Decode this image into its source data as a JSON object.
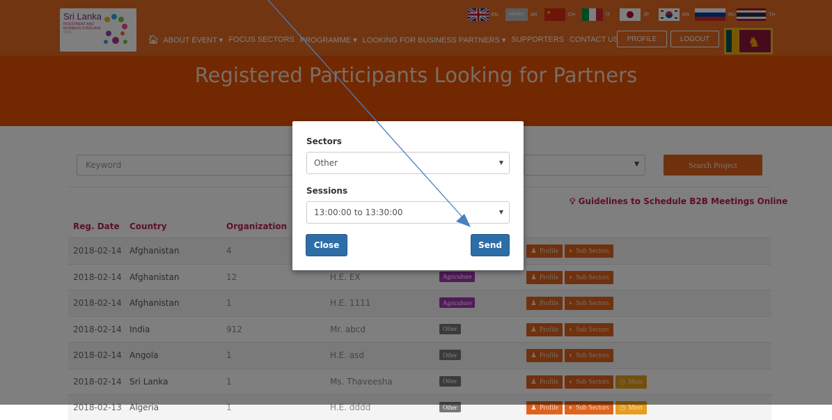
{
  "languages": [
    {
      "code": "EN"
    },
    {
      "code": "ARABIC",
      "label": "AR"
    },
    {
      "code": "CH"
    },
    {
      "code": "IT"
    },
    {
      "code": "JP"
    },
    {
      "code": "KN"
    },
    {
      "code": "RU"
    },
    {
      "code": "TH"
    }
  ],
  "logo": {
    "title": "Sri Lanka",
    "subtitle": "INVESTMENT AND BUSINESS CONCLAVE",
    "year": "2018"
  },
  "nav": {
    "items": [
      "ABOUT EVENT",
      "FOCUS SECTORS",
      "PROGRAMME",
      "LOOKING FOR BUSINESS PARTNERS",
      "SUPPORTERS",
      "CONTACT US"
    ],
    "dropdowns": [
      true,
      false,
      true,
      true,
      false,
      false
    ],
    "profile": "PROFILE",
    "logout": "LOGOUT"
  },
  "hero": {
    "title": "Registered Participants Looking for Partners"
  },
  "search": {
    "keyword_placeholder": "Keyword",
    "search_button": "Search Project"
  },
  "guidelines": "Guidelines to Schedule B2B Meetings Online",
  "table": {
    "headers": [
      "Reg. Date",
      "Country",
      "Organization"
    ],
    "rows": [
      {
        "date": "2018-02-14",
        "country": "Afghanistan",
        "org": "4",
        "name": "",
        "sector": "",
        "meet": false
      },
      {
        "date": "2018-02-14",
        "country": "Afghanistan",
        "org": "12",
        "name": "H.E. EX",
        "sector": "Agriculture",
        "meet": false
      },
      {
        "date": "2018-02-14",
        "country": "Afghanistan",
        "org": "1",
        "name": "H.E. 1111",
        "sector": "Agriculture",
        "meet": false
      },
      {
        "date": "2018-02-14",
        "country": "India",
        "org": "912",
        "name": "Mr. abcd",
        "sector": "Other",
        "meet": false
      },
      {
        "date": "2018-02-14",
        "country": "Angola",
        "org": "1",
        "name": "H.E. asd",
        "sector": "Other",
        "meet": false
      },
      {
        "date": "2018-02-14",
        "country": "Sri Lanka",
        "org": "1",
        "name": "Ms. Thaveesha",
        "sector": "Other",
        "meet": true
      },
      {
        "date": "2018-02-13",
        "country": "Algeria",
        "org": "1",
        "name": "H.E. dddd",
        "sector": "Other",
        "meet": true
      }
    ],
    "profile_label": "Profile",
    "subsectors_label": "Sub Sectors",
    "meet_label": "Meet"
  },
  "modal": {
    "sectors_label": "Sectors",
    "sectors_value": "Other",
    "sessions_label": "Sessions",
    "sessions_value": "13:00:00 to 13:30:00",
    "close": "Close",
    "send": "Send"
  },
  "colors": {
    "brand_orange": "#e36a24",
    "hero_orange": "#e45100",
    "accent_pink": "#c2185b",
    "modal_blue": "#2e6ea8",
    "annotation_arrow": "#4a7fc1"
  }
}
